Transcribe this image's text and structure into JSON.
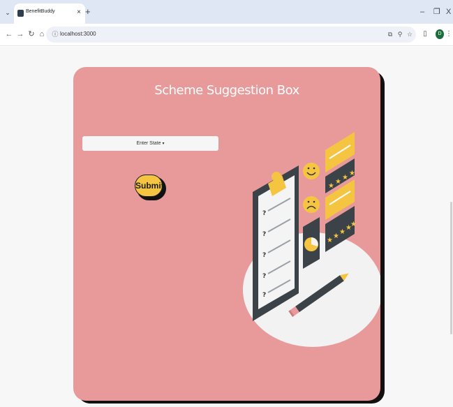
{
  "browser": {
    "tab_title": "BenefitBuddy",
    "tab_close": "×",
    "new_tab": "+",
    "tab_menu": "⌄",
    "url": "localhost:3000",
    "controls": {
      "minimize": "–",
      "restore": "❐",
      "close": "X"
    },
    "profile_initial": "D"
  },
  "page": {
    "title": "Scheme Suggestion Box",
    "state_select": {
      "label": "Enter State",
      "caret": "▾"
    },
    "submit_label": "Submit"
  },
  "colors": {
    "card": "#e89a9a",
    "submit": "#f5c542",
    "tabbar": "#dfe7f5"
  }
}
